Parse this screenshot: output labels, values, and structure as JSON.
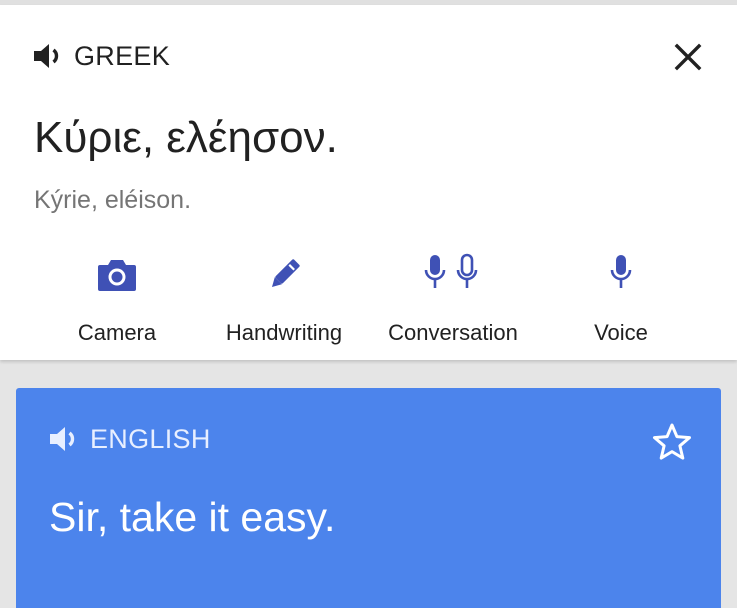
{
  "colors": {
    "accent": "#3f51b5",
    "target_card": "#4c84ec",
    "text_primary": "#212121",
    "text_secondary": "#757575"
  },
  "source": {
    "language_label": "GREEK",
    "speaker_icon": "volume-icon",
    "close_icon": "close-icon",
    "text": "Κύριε, ελέησον.",
    "transliteration": "Kýrie, eléison."
  },
  "tools": [
    {
      "label": "Camera",
      "icon": "camera-icon"
    },
    {
      "label": "Handwriting",
      "icon": "pen-icon"
    },
    {
      "label": "Conversation",
      "icon": "two-microphones-icon"
    },
    {
      "label": "Voice",
      "icon": "microphone-icon"
    }
  ],
  "target": {
    "language_label": "ENGLISH",
    "speaker_icon": "volume-icon",
    "star_icon": "star-outline-icon",
    "text": "Sir, take it easy."
  }
}
